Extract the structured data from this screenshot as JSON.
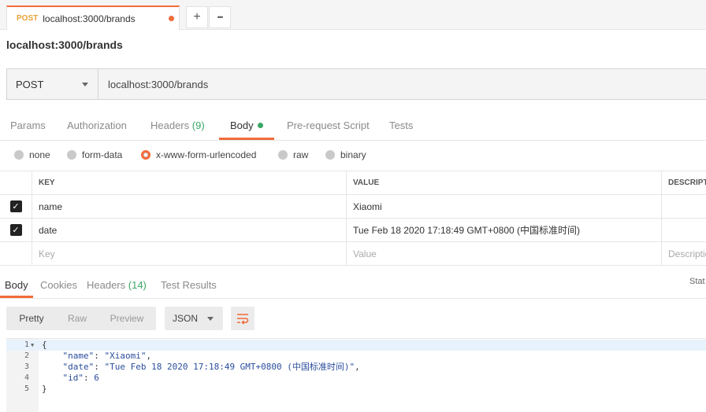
{
  "tab": {
    "method": "POST",
    "name": "localhost:3000/brands"
  },
  "tab_buttons": {
    "add": "+",
    "more": "•••"
  },
  "request_title": "localhost:3000/brands",
  "method": "POST",
  "url": "localhost:3000/brands",
  "request_tabs": {
    "params": "Params",
    "authorization": "Authorization",
    "headers": "Headers",
    "headers_count": "(9)",
    "body": "Body",
    "prerequest": "Pre-request Script",
    "tests": "Tests"
  },
  "body_types": {
    "none": "none",
    "form_data": "form-data",
    "urlencoded": "x-www-form-urlencoded",
    "raw": "raw",
    "binary": "binary",
    "selected": "x-www-form-urlencoded"
  },
  "table": {
    "headers": {
      "key": "KEY",
      "value": "VALUE",
      "description": "DESCRIPTIO"
    },
    "rows": [
      {
        "key": "name",
        "value": "Xiaomi",
        "checked": true
      },
      {
        "key": "date",
        "value": "Tue Feb 18 2020 17:18:49 GMT+0800 (中国标准时间)",
        "checked": true
      }
    ],
    "placeholders": {
      "key": "Key",
      "value": "Value",
      "description": "Descriptio"
    }
  },
  "response_tabs": {
    "body": "Body",
    "cookies": "Cookies",
    "headers": "Headers",
    "headers_count": "(14)",
    "test_results": "Test Results",
    "status": "Stat"
  },
  "view": {
    "pretty": "Pretty",
    "raw": "Raw",
    "preview": "Preview",
    "format": "JSON"
  },
  "response_lines": [
    {
      "n": "1",
      "text": "{"
    },
    {
      "n": "2",
      "key": "\"name\"",
      "val": "\"Xiaomi\"",
      "end": ","
    },
    {
      "n": "3",
      "key": "\"date\"",
      "val": "\"Tue Feb 18 2020 17:18:49 GMT+0800 (中国标准时间)\"",
      "end": ","
    },
    {
      "n": "4",
      "key": "\"id\"",
      "val": "6",
      "end": ""
    },
    {
      "n": "5",
      "text": "}"
    }
  ],
  "colors": {
    "accent": "#f26b3a",
    "green": "#3aa765",
    "method_tab": "#e8a23a"
  }
}
